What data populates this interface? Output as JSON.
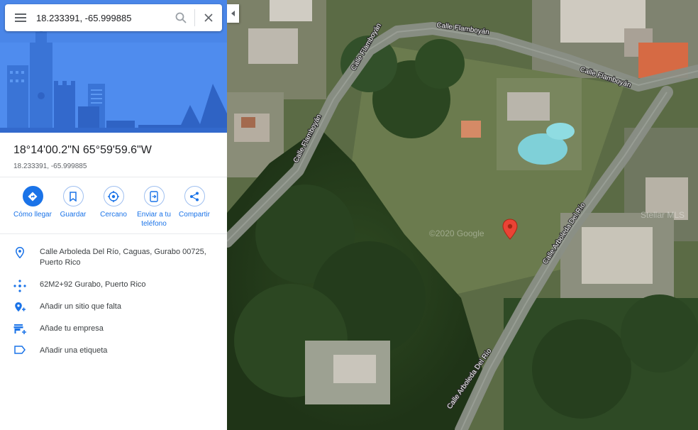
{
  "search": {
    "value": "18.233391, -65.999885"
  },
  "place": {
    "title": "18°14'00.2\"N 65°59'59.6\"W",
    "subtitle": "18.233391, -65.999885"
  },
  "actions": [
    {
      "label": "Cómo llegar",
      "icon": "directions-icon"
    },
    {
      "label": "Guardar",
      "icon": "bookmark-icon"
    },
    {
      "label": "Cercano",
      "icon": "nearby-icon"
    },
    {
      "label": "Enviar a tu teléfono",
      "icon": "send-to-phone-icon"
    },
    {
      "label": "Compartir",
      "icon": "share-icon"
    }
  ],
  "info": [
    {
      "text": "Calle Arboleda Del Río, Caguas, Gurabo 00725, Puerto Rico",
      "icon": "location-pin-icon"
    },
    {
      "text": "62M2+92 Gurabo, Puerto Rico",
      "icon": "plus-code-icon"
    },
    {
      "text": "Añadir un sitio que falta",
      "icon": "add-place-icon"
    },
    {
      "text": "Añade tu empresa",
      "icon": "add-business-icon"
    },
    {
      "text": "Añadir una etiqueta",
      "icon": "label-icon"
    }
  ],
  "map": {
    "streets": [
      "Calle Flamboyán",
      "Calle Flamboyán",
      "Calle Flamboyán",
      "Calle Arboleda Del Río",
      "Calle Arboleda Del Río"
    ],
    "watermarks": [
      "Stellar MLS",
      "©2020 Google"
    ]
  },
  "colors": {
    "accent": "#1a73e8",
    "hero": "#4a86e8",
    "pin": "#ea4335"
  }
}
